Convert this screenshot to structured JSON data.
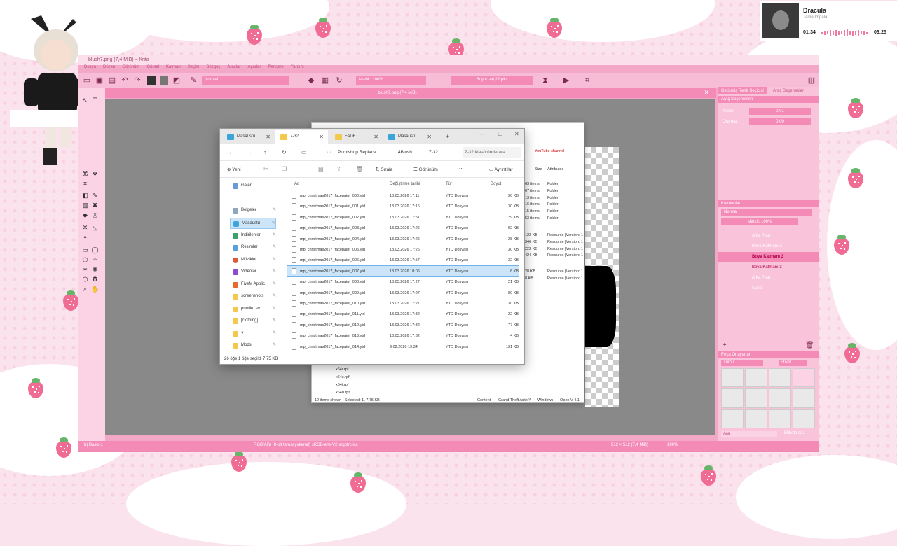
{
  "music": {
    "title": "Dracula",
    "artist": "Tame Impala",
    "elapsed": "01:34",
    "total": "03:25"
  },
  "krita": {
    "title": "blush7.png (7,4 MiB) – Krita",
    "menu": [
      "Dosya",
      "Düzen",
      "Görünüm",
      "Görsel",
      "Katman",
      "Seçim",
      "Süzgeç",
      "Araçlar",
      "Ayarlar",
      "Pencere",
      "Yardım"
    ],
    "blend_mode": "Normal",
    "opacity": "Matlık: 100%",
    "size": "Boyut: 46,22 pks",
    "canvas_tab": "blush7.png (7,4 MiB)",
    "statusbar_left": "b) Basic-1",
    "statusbar_mid": "RGB/Alfa (8-bit tamsayı/kanal) sRGB-elle-V2-srgbtrc.icc",
    "statusbar_right": "512 × 512 (7,4 MiB)",
    "zoom": "100%",
    "right_tabs": [
      "Gelişmiş Renk Seçicisi",
      "Araç Seçenekleri"
    ],
    "tool_options_title": "Araç Seçenekleri",
    "tool_options": {
      "flow_label": "Kalite:",
      "flow_value": "0,01",
      "mode_label": "Oturma:",
      "mode_value": "0,00"
    },
    "layers_title": "Katmanlar",
    "layers_mode": "Normal",
    "layers_opacity": "Matlık: 100%",
    "layers": [
      "Arka Plan",
      "Boya Katmanı 2",
      "Boya Katmanı 3",
      "Boya Katmanı 3",
      "Arka Plan",
      "Sunet"
    ],
    "brush_title": "Fırça Önayarları",
    "brush_tag": "Tümü",
    "brush_filter": "Etiket",
    "brush_search": "Ara",
    "brush_tag_filter": "Etikete süz"
  },
  "explorer": {
    "tabs": [
      "Masaüstü",
      "7-32",
      "FADE",
      "Masaüstü"
    ],
    "breadcrumb": [
      "Pumishop Replace",
      "4Blush",
      "7-32"
    ],
    "search_placeholder": "7-32 klasöründe ara",
    "cmd": {
      "new": "Yeni",
      "sort": "Sırala",
      "view": "Görünüm",
      "details": "Ayrıntılar"
    },
    "nav": [
      "Galeri",
      "Belgeler",
      "Masaüstü",
      "İndirilenler",
      "Resimler",
      "Müzikler",
      "Videolar",
      "FiveM Applic",
      "screenshots",
      "pumiko sv",
      "[clothing]",
      "♥",
      "Mods"
    ],
    "columns": [
      "Ad",
      "Değiştirme tarihi",
      "Tür",
      "Boyut"
    ],
    "files": [
      {
        "name": "mp_christmas2017_facepaint_000.ytd",
        "date": "13.03.2026 17:11",
        "type": "YTD Dosyası",
        "size": "30 KB"
      },
      {
        "name": "mp_christmas2017_facepaint_001.ytd",
        "date": "13.03.2026 17:16",
        "type": "YTD Dosyası",
        "size": "30 KB"
      },
      {
        "name": "mp_christmas2017_facepaint_002.ytd",
        "date": "13.03.2026 17:51",
        "type": "YTD Dosyası",
        "size": "29 KB"
      },
      {
        "name": "mp_christmas2017_facepaint_003.ytd",
        "date": "13.03.2026 17:26",
        "type": "YTD Dosyası",
        "size": "92 KB"
      },
      {
        "name": "mp_christmas2017_facepaint_004.ytd",
        "date": "13.03.2026 17:26",
        "type": "YTD Dosyası",
        "size": "28 KB"
      },
      {
        "name": "mp_christmas2017_facepaint_005.ytd",
        "date": "13.03.2026 17:26",
        "type": "YTD Dosyası",
        "size": "30 KB"
      },
      {
        "name": "mp_christmas2017_facepaint_006.ytd",
        "date": "13.03.2026 17:57",
        "type": "YTD Dosyası",
        "size": "32 KB"
      },
      {
        "name": "mp_christmas2017_facepaint_007.ytd",
        "date": "13.03.2026 18:06",
        "type": "YTD Dosyası",
        "size": "8 KB"
      },
      {
        "name": "mp_christmas2017_facepaint_008.ytd",
        "date": "13.03.2026 17:27",
        "type": "YTD Dosyası",
        "size": "21 KB"
      },
      {
        "name": "mp_christmas2017_facepaint_009.ytd",
        "date": "13.03.2026 17:27",
        "type": "YTD Dosyası",
        "size": "80 KB"
      },
      {
        "name": "mp_christmas2017_facepaint_010.ytd",
        "date": "13.03.2026 17:27",
        "type": "YTD Dosyası",
        "size": "30 KB"
      },
      {
        "name": "mp_christmas2017_facepaint_011.ytd",
        "date": "13.03.2026 17:32",
        "type": "YTD Dosyası",
        "size": "22 KB"
      },
      {
        "name": "mp_christmas2017_facepaint_012.ytd",
        "date": "13.03.2026 17:32",
        "type": "YTD Dosyası",
        "size": "77 KB"
      },
      {
        "name": "mp_christmas2017_facepaint_013.ytd",
        "date": "13.03.2026 17:32",
        "type": "YTD Dosyası",
        "size": "4 KB"
      },
      {
        "name": "mp_christmas2017_facepaint_014.ytd",
        "date": "9.02.2026 19:34",
        "type": "YTD Dosyası",
        "size": "131 KB"
      }
    ],
    "selected_index": 7,
    "status": "26 öğe    1 öğe seçildi  7,75 KB"
  },
  "explorer2": {
    "yt": "YouTube channel",
    "cols": [
      "Size",
      "Attributes"
    ],
    "rows": [
      {
        "size": "63 items",
        "attr": "Folder"
      },
      {
        "size": "67 items",
        "attr": "Folder"
      },
      {
        "size": "13 items",
        "attr": "Folder"
      },
      {
        "size": "16 items",
        "attr": "Folder"
      },
      {
        "size": "15 items",
        "attr": "Folder"
      },
      {
        "size": "53 items",
        "attr": "Folder"
      },
      {
        "size": "122 KB",
        "attr": "Resource [Version: 1"
      },
      {
        "size": "346 KB",
        "attr": "Resource [Version: 1"
      },
      {
        "size": "223 KB",
        "attr": "Resource [Version: 1"
      },
      {
        "size": "424 KB",
        "attr": "Resource [Version: 1"
      },
      {
        "size": "28 KB",
        "attr": "Resource [Version: 1"
      },
      {
        "size": "8 KB",
        "attr": "Resource [Version: 1"
      }
    ],
    "files": [
      "x64r.rpf",
      "x64s.rpf",
      "x64t.rpf",
      "x64u.rpf"
    ],
    "status": "12 items shown | Selected: 1,  7,75 KB",
    "footer": [
      "Content",
      "Grand Theft Auto V",
      "Windows",
      "OpenIV 4.1"
    ]
  }
}
